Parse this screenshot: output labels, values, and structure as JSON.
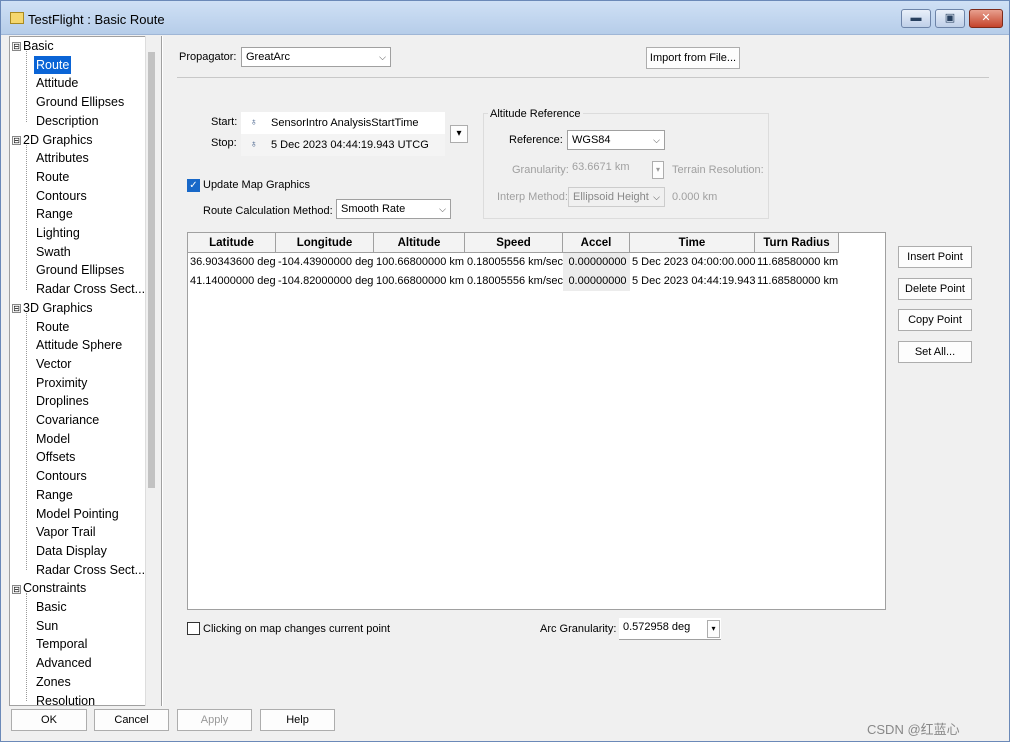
{
  "window": {
    "title": "TestFlight : Basic Route",
    "min": "▬",
    "max": "▣",
    "close": "✕"
  },
  "tree": {
    "groups": [
      {
        "label": "Basic",
        "toggle": "⊟",
        "items": [
          "Route",
          "Attitude",
          "Ground Ellipses",
          "Description"
        ]
      },
      {
        "label": "2D Graphics",
        "toggle": "⊟",
        "items": [
          "Attributes",
          "Route",
          "Contours",
          "Range",
          "Lighting",
          "Swath",
          "Ground Ellipses",
          "Radar Cross Sect..."
        ]
      },
      {
        "label": "3D Graphics",
        "toggle": "⊟",
        "items": [
          "Route",
          "Attitude Sphere",
          "Vector",
          "Proximity",
          "Droplines",
          "Covariance",
          "Model",
          "Offsets",
          "Contours",
          "Range",
          "Model Pointing",
          "Vapor Trail",
          "Data Display",
          "Radar Cross Sect..."
        ]
      },
      {
        "label": "Constraints",
        "toggle": "⊟",
        "items": [
          "Basic",
          "Sun",
          "Temporal",
          "Advanced",
          "Zones",
          "Resolution"
        ]
      }
    ],
    "selected": "Route"
  },
  "propagator": {
    "label": "Propagator:",
    "value": "GreatArc",
    "import_label": "Import from File..."
  },
  "times": {
    "start_label": "Start:",
    "start_value": "SensorIntro AnalysisStartTime",
    "stop_label": "Stop:",
    "stop_value": "5 Dec 2023 04:44:19.943 UTCG",
    "menu_glyph": "▾",
    "icon": "♁"
  },
  "altitude": {
    "group_label": "Altitude Reference",
    "reference_label": "Reference:",
    "reference_value": "WGS84",
    "granularity_label": "Granularity:",
    "granularity_value": "63.6671 km",
    "terrain_label": "Terrain Resolution:",
    "interp_label": "Interp Method:",
    "interp_value": "Ellipsoid Height",
    "terrain_value": "0.000 km"
  },
  "update_map": {
    "label": "Update Map Graphics",
    "checked": true
  },
  "route_calc": {
    "label": "Route Calculation Method:",
    "value": "Smooth Rate"
  },
  "table": {
    "columns": [
      "Latitude",
      "Longitude",
      "Altitude",
      "Speed",
      "Accel",
      "Time",
      "Turn Radius"
    ],
    "rows": [
      [
        "36.90343600 deg",
        "-104.43900000 deg",
        "100.66800000 km",
        "0.18005556 km/sec",
        "0.00000000",
        "5 Dec 2023 04:00:00.000",
        "11.68580000 km"
      ],
      [
        "41.14000000 deg",
        "-104.82000000 deg",
        "100.66800000 km",
        "0.18005556 km/sec",
        "0.00000000",
        "5 Dec 2023 04:44:19.943",
        "11.68580000 km"
      ]
    ]
  },
  "side_buttons": [
    "Insert Point",
    "Delete Point",
    "Copy Point",
    "Set All..."
  ],
  "click_map": {
    "label": "Clicking on map changes current point",
    "checked": false
  },
  "arc": {
    "label": "Arc Granularity:",
    "value": "0.572958 deg"
  },
  "footer": {
    "ok": "OK",
    "cancel": "Cancel",
    "apply": "Apply",
    "help": "Help"
  },
  "watermark": "CSDN @红蓝心"
}
